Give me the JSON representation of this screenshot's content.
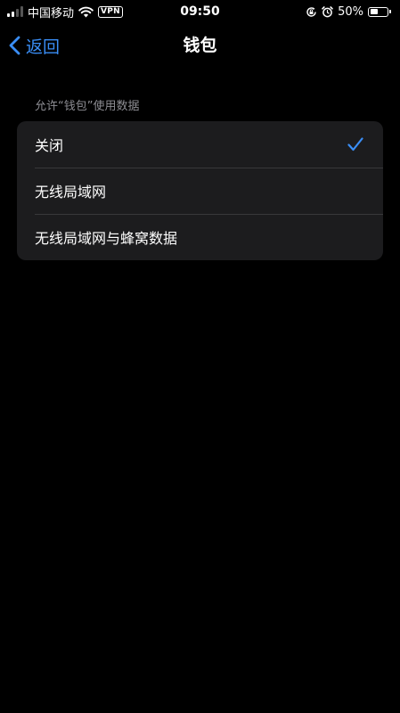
{
  "status_bar": {
    "carrier": "中国移动",
    "vpn_label": "VPN",
    "time": "09:50",
    "battery_percent": "50%",
    "battery_level": 0.5,
    "icons": [
      "signal-icon",
      "wifi-icon",
      "orientation-lock-icon",
      "alarm-icon",
      "battery-icon"
    ]
  },
  "nav": {
    "back_label": "返回",
    "title": "钱包"
  },
  "section": {
    "header": "允许“钱包”使用数据",
    "options": [
      {
        "label": "关闭",
        "selected": true
      },
      {
        "label": "无线局域网",
        "selected": false
      },
      {
        "label": "无线局域网与蜂窝数据",
        "selected": false
      }
    ]
  },
  "colors": {
    "background": "#000000",
    "group_background": "#1c1c1e",
    "accent": "#3a8ef6",
    "secondary_text": "#8d8d93",
    "separator": "#38383a"
  }
}
